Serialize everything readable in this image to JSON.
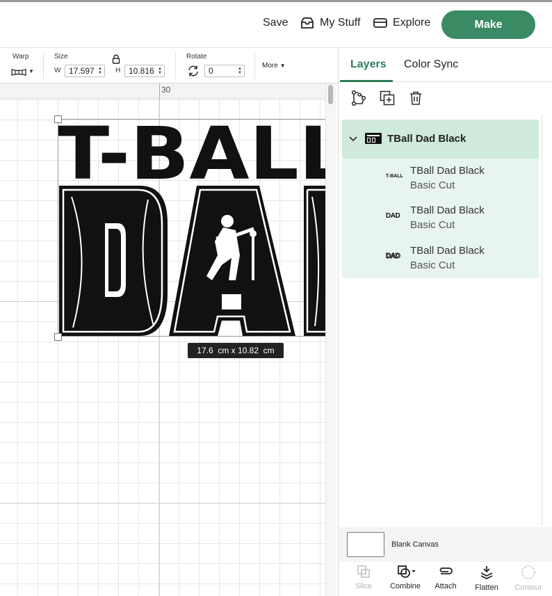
{
  "header": {
    "save_label": "Save",
    "my_stuff_label": "My Stuff",
    "explore_label": "Explore",
    "make_label": "Make",
    "make_color": "#3a8a63"
  },
  "toolbar": {
    "warp_label": "Warp",
    "size_label": "Size",
    "w_label": "W",
    "w_value": "17.597",
    "h_label": "H",
    "h_value": "10.816",
    "rotate_label": "Rotate",
    "rotate_value": "0",
    "more_label": "More"
  },
  "canvas": {
    "ruler_mark": "30",
    "dimension_readout": "17.6  cm x 10.82  cm",
    "design_text_top": "T-BALL",
    "design_text_main": "DAD"
  },
  "panel": {
    "tabs": [
      {
        "label": "Layers",
        "active": true
      },
      {
        "label": "Color Sync",
        "active": false
      }
    ],
    "accent_color": "#2e7d57",
    "group": {
      "name": "TBall Dad Black"
    },
    "layers": [
      {
        "name": "TBall Dad Black",
        "type": "Basic Cut",
        "thumb": "T-BALL"
      },
      {
        "name": "TBall Dad Black",
        "type": "Basic Cut",
        "thumb": "DAD"
      },
      {
        "name": "TBall Dad Black",
        "type": "Basic Cut",
        "thumb": "DAD"
      }
    ],
    "blank_canvas_label": "Blank Canvas",
    "bottom_tools": [
      {
        "label": "Slice",
        "enabled": false,
        "icon": "slice-icon"
      },
      {
        "label": "Combine",
        "enabled": true,
        "icon": "combine-icon"
      },
      {
        "label": "Attach",
        "enabled": true,
        "icon": "attach-icon"
      },
      {
        "label": "Flatten",
        "enabled": true,
        "icon": "flatten-icon"
      },
      {
        "label": "Contour",
        "enabled": false,
        "icon": "contour-icon"
      }
    ]
  }
}
